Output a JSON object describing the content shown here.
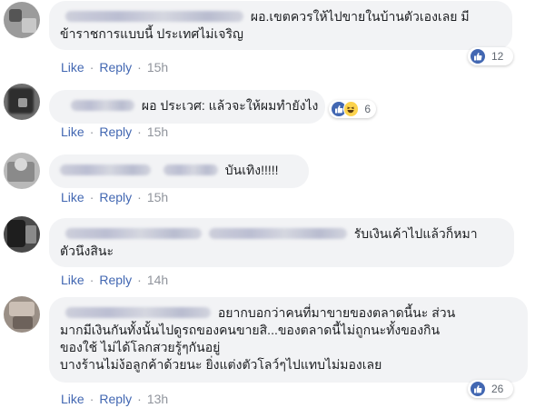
{
  "colors": {
    "link": "#4267b2",
    "meta_text": "#90949c",
    "bubble_bg": "#f2f3f5",
    "like_blue": "#4267b2"
  },
  "actions": {
    "like_label": "Like",
    "reply_label": "Reply",
    "separator": "·"
  },
  "comments": [
    {
      "lines": [
        "ผอ.เขตควรให้ไปขายในบ้านตัวเองเลย มี",
        "ข้าราชการแบบนี้ ประเทศไม่เจริญ"
      ],
      "time": "15h",
      "reaction_icons": [
        "like-icon"
      ],
      "reaction_count": "12"
    },
    {
      "lines": [
        "ผอ ประเวศ: แล้วจะให้ผมทำยังไง"
      ],
      "time": "15h",
      "reaction_icons": [
        "like-icon",
        "haha-icon"
      ],
      "reaction_count": "6"
    },
    {
      "lines": [
        "บันเทิง!!!!!"
      ],
      "time": "15h"
    },
    {
      "lines": [
        "รับเงินเค้าไปแล้วก็หมา",
        "ตัวนึงสินะ"
      ],
      "time": "14h"
    },
    {
      "lines": [
        "อยากบอกว่าคนที่มาขายของตลาดนี้นะ ส่วน",
        "มากมีเงินกันทั้งนั้นไปดูรถของคนขายสิ...ของตลาดนี้ไม่ถูกนะทั้งของกิน",
        "ของใช้ ไม่ได้โลกสวยรู้ๆกันอยู่",
        "บางร้านไม่ง้อลูกค้าด้วยนะ ยิ่งแต่งตัวโลว์ๆไปแทบไม่มองเลย"
      ],
      "time": "13h",
      "reaction_icons": [
        "like-icon"
      ],
      "reaction_count": "26"
    }
  ]
}
